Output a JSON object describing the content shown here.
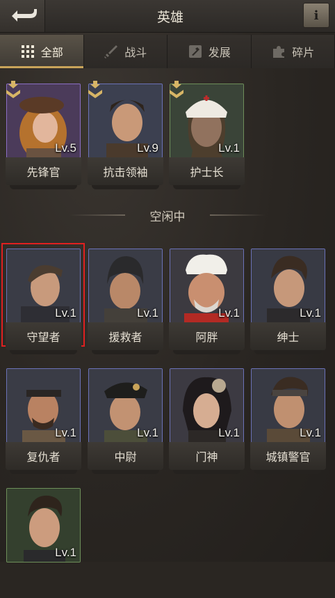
{
  "header": {
    "title": "英雄",
    "info_label": "i"
  },
  "tabs": [
    {
      "label": "全部",
      "icon": "grid-icon",
      "active": true
    },
    {
      "label": "战斗",
      "icon": "sword-icon",
      "active": false
    },
    {
      "label": "发展",
      "icon": "hammer-icon",
      "active": false
    },
    {
      "label": "碎片",
      "icon": "puzzle-icon",
      "active": false
    }
  ],
  "deployed_heroes": [
    {
      "name": "先锋官",
      "level": "Lv.5",
      "rarity": "purple"
    },
    {
      "name": "抗击领袖",
      "level": "Lv.9",
      "rarity": "blue"
    },
    {
      "name": "护士长",
      "level": "Lv.1",
      "rarity": "green"
    }
  ],
  "idle_section": {
    "label": "空闲中"
  },
  "idle_heroes": [
    {
      "name": "守望者",
      "level": "Lv.1",
      "rarity": "blue",
      "selected": true
    },
    {
      "name": "援救者",
      "level": "Lv.1",
      "rarity": "blue"
    },
    {
      "name": "阿胖",
      "level": "Lv.1",
      "rarity": "blue"
    },
    {
      "name": "绅士",
      "level": "Lv.1",
      "rarity": "blue"
    },
    {
      "name": "复仇者",
      "level": "Lv.1",
      "rarity": "blue"
    },
    {
      "name": "中尉",
      "level": "Lv.1",
      "rarity": "blue"
    },
    {
      "name": "门神",
      "level": "Lv.1",
      "rarity": "blue"
    },
    {
      "name": "城镇警官",
      "level": "Lv.1",
      "rarity": "blue"
    },
    {
      "name": "",
      "level": "Lv.1",
      "rarity": "green"
    }
  ],
  "colors": {
    "background": "#2a2622",
    "tab_active": "#5a5348",
    "selection": "#e02020",
    "accent_gold": "#c9a45a"
  }
}
